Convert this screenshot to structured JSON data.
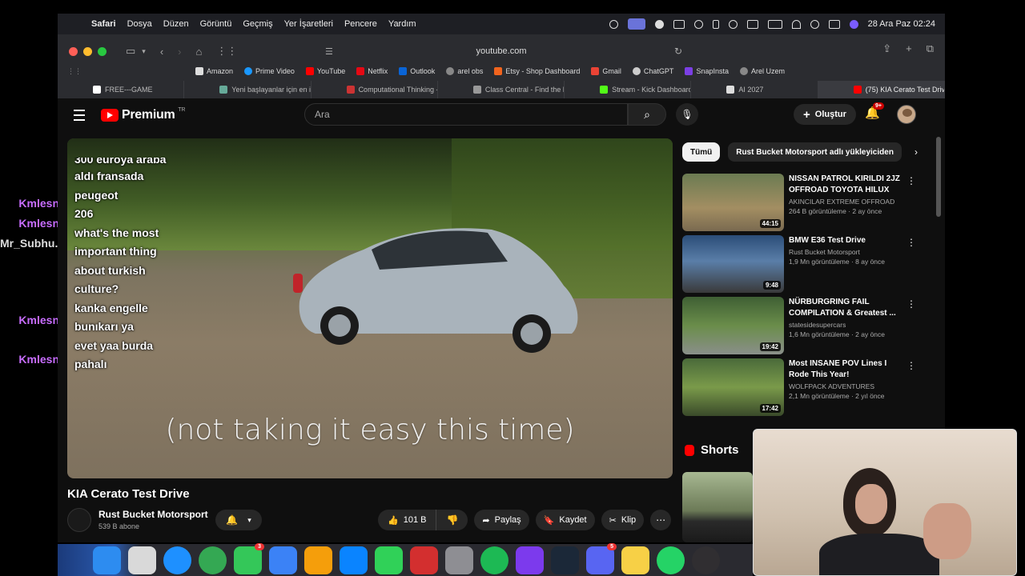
{
  "menubar": {
    "app": "Safari",
    "items": [
      "Dosya",
      "Düzen",
      "Görüntü",
      "Geçmiş",
      "Yer İşaretleri",
      "Pencere",
      "Yardım"
    ],
    "clock": "28 Ara Paz  02:24"
  },
  "safari": {
    "url": "youtube.com",
    "bookmarks": [
      {
        "label": "Amazon",
        "color": "#ddd"
      },
      {
        "label": "Prime Video",
        "color": "#1a98ff"
      },
      {
        "label": "YouTube",
        "color": "#ff0000"
      },
      {
        "label": "Netflix",
        "color": "#e50914"
      },
      {
        "label": "Outlook",
        "color": "#0a64d6"
      },
      {
        "label": "arel obs",
        "color": "#888"
      },
      {
        "label": "Etsy - Shop Dashboard",
        "color": "#f1641e"
      },
      {
        "label": "Gmail",
        "color": "#ea4335"
      },
      {
        "label": "ChatGPT",
        "color": "#ccc"
      },
      {
        "label": "SnapInsta",
        "color": "#7b3fe4"
      },
      {
        "label": "Arel Uzem",
        "color": "#888"
      }
    ],
    "tabs": [
      {
        "label": "FREE---GAME",
        "color": "#fff"
      },
      {
        "label": "Yeni başlayanlar için en iyi AI...",
        "color": "#6a9"
      },
      {
        "label": "Computational Thinking - CS...",
        "color": "#c33"
      },
      {
        "label": "Class Central - Find the best...",
        "color": "#999"
      },
      {
        "label": "Stream - Kick Dashboard",
        "color": "#53fc18"
      },
      {
        "label": "AI 2027",
        "color": "#ddd"
      },
      {
        "label": "(75) KIA Cerato Test Drive -...",
        "color": "#f00"
      }
    ]
  },
  "youtube": {
    "logo": "Premium",
    "logo_region": "TR",
    "search_placeholder": "Ara",
    "create_label": "Oluştur",
    "notif_badge": "9+",
    "video": {
      "subtitle": "(not taking it easy this time)",
      "chat_lines": [
        "300 euroya araba",
        "aldı fransada",
        "peugeot",
        "206",
        "what's the most",
        "important thing",
        "about turkish",
        "culture?",
        "kanka engelle",
        "bunıkarı ya",
        "evet yaa burda",
        "pahalı"
      ],
      "title": "KIA Cerato Test Drive",
      "channel": "Rust Bucket Motorsport",
      "subscribers": "539 B abone",
      "likes": "101 B",
      "share": "Paylaş",
      "save": "Kaydet",
      "clip": "Klip"
    },
    "chips": [
      "Tümü",
      "Rust Bucket Motorsport adlı yükleyiciden"
    ],
    "recommendations": [
      {
        "title": "NISSAN PATROL KIRILDI 2JZ OFFROAD TOYOTA HILUX L20...",
        "channel": "AKINCILAR EXTREME OFFROAD",
        "meta": "264 B görüntüleme · 2 ay önce",
        "duration": "44:15"
      },
      {
        "title": "BMW E36 Test Drive",
        "channel": "Rust Bucket Motorsport",
        "meta": "1,9 Mn görüntüleme · 8 ay önce",
        "duration": "9:48"
      },
      {
        "title": "NÜRBURGRING FAIL COMPILATION & Greatest ...",
        "channel": "statesidesupercars",
        "meta": "1,6 Mn görüntüleme · 2 ay önce",
        "duration": "19:42"
      },
      {
        "title": "Most INSANE POV Lines I Rode This Year!",
        "channel": "WOLFPACK ADVENTURES",
        "meta": "2,1 Mn görüntüleme · 2 yıl önce",
        "duration": "17:42"
      }
    ],
    "shorts_label": "Shorts"
  },
  "stream_chat": {
    "names": [
      "Kmlesn",
      "Kmlesn",
      "Mr_Subhu...",
      "Kmlesn",
      "Kmlesn"
    ]
  },
  "dock": {
    "apps": [
      {
        "name": "finder",
        "color": "#2d8cf0"
      },
      {
        "name": "launchpad",
        "color": "#d9d9d9"
      },
      {
        "name": "safari",
        "color": "#1e90ff"
      },
      {
        "name": "chrome",
        "color": "#34a853"
      },
      {
        "name": "messages",
        "color": "#34c759",
        "badge": "3"
      },
      {
        "name": "mail",
        "color": "#3b82f6"
      },
      {
        "name": "photos",
        "color": "#f59e0b"
      },
      {
        "name": "app-store",
        "color": "#0a84ff"
      },
      {
        "name": "facetime",
        "color": "#30d158"
      },
      {
        "name": "acrobat",
        "color": "#d32f2f"
      },
      {
        "name": "system-settings",
        "color": "#8e8e93"
      },
      {
        "name": "spotify",
        "color": "#1db954"
      },
      {
        "name": "prime-video",
        "color": "#7c3aed"
      },
      {
        "name": "steam",
        "color": "#1b2838"
      },
      {
        "name": "discord",
        "color": "#5865f2",
        "badge": "5"
      },
      {
        "name": "notes",
        "color": "#f7d046"
      },
      {
        "name": "whatsapp",
        "color": "#25d366"
      },
      {
        "name": "obs",
        "color": "#302e31"
      }
    ]
  }
}
